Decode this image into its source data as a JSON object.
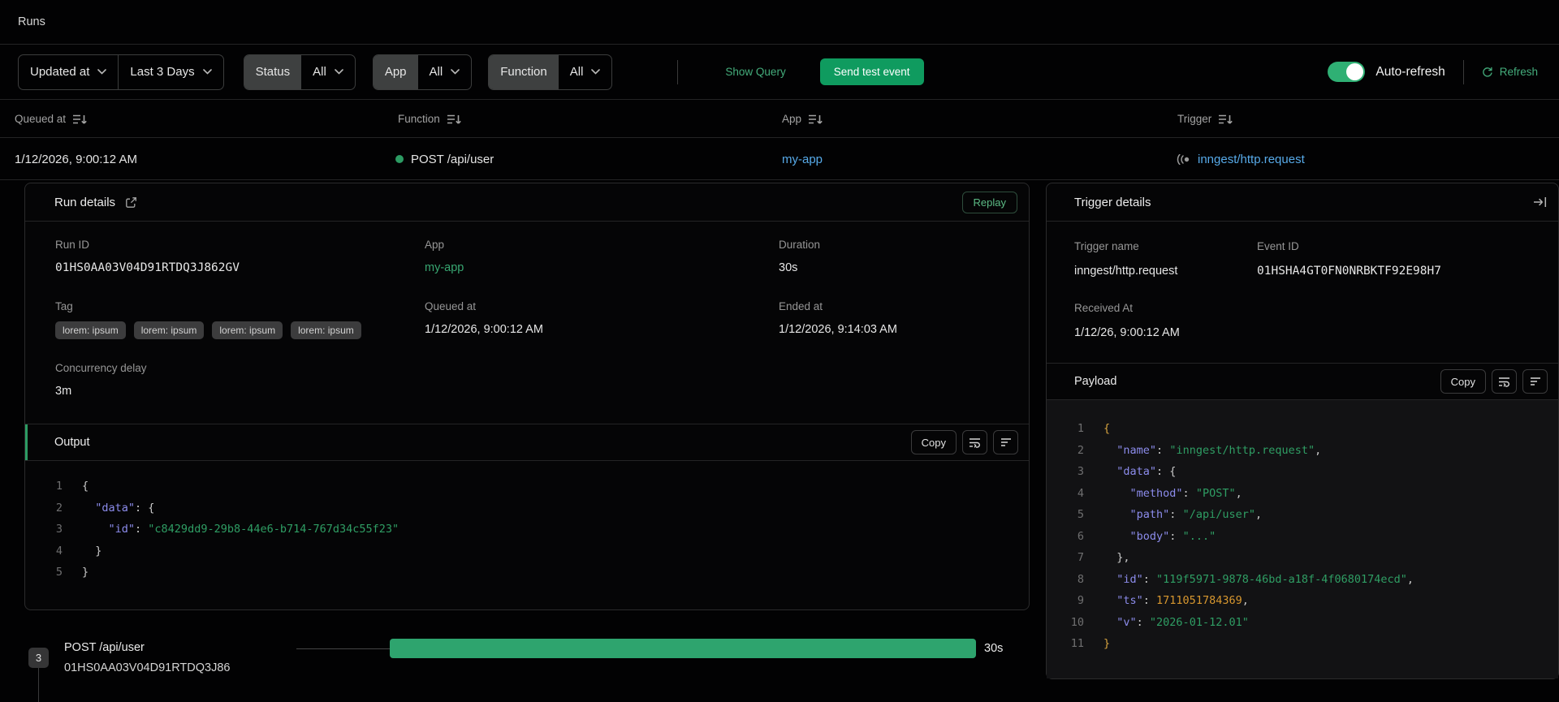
{
  "colors": {
    "accent_green": "#2c9b63",
    "link_blue": "#57aae9",
    "bar_green": "#2ea46e",
    "key_purple": "#8c8cec",
    "number_orange": "#d7972f"
  },
  "header": {
    "title": "Runs"
  },
  "filters": {
    "sort_field": "Updated at",
    "time_range": "Last 3 Days",
    "status_label": "Status",
    "status_value": "All",
    "app_label": "App",
    "app_value": "All",
    "function_label": "Function",
    "function_value": "All",
    "show_query": "Show Query",
    "send_test_event": "Send test event",
    "auto_refresh": "Auto-refresh",
    "refresh": "Refresh"
  },
  "table": {
    "headers": {
      "queued_at": "Queued at",
      "function": "Function",
      "app": "App",
      "trigger": "Trigger"
    },
    "row": {
      "queued_at": "1/12/2026, 9:00:12 AM",
      "function": "POST /api/user",
      "app": "my-app",
      "trigger": "inngest/http.request"
    }
  },
  "run_details": {
    "title": "Run details",
    "replay": "Replay",
    "run_id_label": "Run ID",
    "run_id": "01HS0AA03V04D91RTDQ3J862GV",
    "app_label": "App",
    "app": "my-app",
    "duration_label": "Duration",
    "duration": "30s",
    "tag_label": "Tag",
    "tags": [
      "lorem: ipsum",
      "lorem: ipsum",
      "lorem: ipsum",
      "lorem: ipsum"
    ],
    "queued_at_label": "Queued at",
    "queued_at": "1/12/2026, 9:00:12 AM",
    "ended_at_label": "Ended at",
    "ended_at": "1/12/2026, 9:14:03 AM",
    "concurrency_label": "Concurrency delay",
    "concurrency": "3m"
  },
  "output": {
    "title": "Output",
    "copy": "Copy",
    "code": [
      {
        "n": "1",
        "tokens": [
          [
            "punc",
            "{"
          ]
        ]
      },
      {
        "n": "2",
        "tokens": [
          [
            "punc",
            "  "
          ],
          [
            "key",
            "\"data\""
          ],
          [
            "punc",
            ": {"
          ]
        ]
      },
      {
        "n": "3",
        "tokens": [
          [
            "punc",
            "    "
          ],
          [
            "key",
            "\"id\""
          ],
          [
            "punc",
            ": "
          ],
          [
            "str",
            "\"c8429dd9-29b8-44e6-b714-767d34c55f23\""
          ]
        ]
      },
      {
        "n": "4",
        "tokens": [
          [
            "punc",
            "  }"
          ]
        ]
      },
      {
        "n": "5",
        "tokens": [
          [
            "punc",
            "}"
          ]
        ]
      }
    ]
  },
  "trigger_details": {
    "title": "Trigger details",
    "trigger_name_label": "Trigger name",
    "trigger_name": "inngest/http.request",
    "event_id_label": "Event ID",
    "event_id": "01HSHA4GT0FN0NRBKTF92E98H7",
    "received_at_label": "Received At",
    "received_at": "1/12/26, 9:00:12 AM",
    "payload": {
      "title": "Payload",
      "copy": "Copy",
      "code": [
        {
          "n": "1",
          "tokens": [
            [
              "brace",
              "{"
            ]
          ]
        },
        {
          "n": "2",
          "tokens": [
            [
              "punc",
              "  "
            ],
            [
              "key",
              "\"name\""
            ],
            [
              "punc",
              ": "
            ],
            [
              "str",
              "\"inngest/http.request\""
            ],
            [
              "punc",
              ","
            ]
          ]
        },
        {
          "n": "3",
          "tokens": [
            [
              "punc",
              "  "
            ],
            [
              "key",
              "\"data\""
            ],
            [
              "punc",
              ": {"
            ]
          ]
        },
        {
          "n": "4",
          "tokens": [
            [
              "punc",
              "    "
            ],
            [
              "key",
              "\"method\""
            ],
            [
              "punc",
              ": "
            ],
            [
              "str",
              "\"POST\""
            ],
            [
              "punc",
              ","
            ]
          ]
        },
        {
          "n": "5",
          "tokens": [
            [
              "punc",
              "    "
            ],
            [
              "key",
              "\"path\""
            ],
            [
              "punc",
              ": "
            ],
            [
              "str",
              "\"/api/user\""
            ],
            [
              "punc",
              ","
            ]
          ]
        },
        {
          "n": "6",
          "tokens": [
            [
              "punc",
              "    "
            ],
            [
              "key",
              "\"body\""
            ],
            [
              "punc",
              ": "
            ],
            [
              "str",
              "\"...\""
            ]
          ]
        },
        {
          "n": "7",
          "tokens": [
            [
              "punc",
              "  },"
            ]
          ]
        },
        {
          "n": "8",
          "tokens": [
            [
              "punc",
              "  "
            ],
            [
              "key",
              "\"id\""
            ],
            [
              "punc",
              ": "
            ],
            [
              "str",
              "\"119f5971-9878-46bd-a18f-4f0680174ecd\""
            ],
            [
              "punc",
              ","
            ]
          ]
        },
        {
          "n": "9",
          "tokens": [
            [
              "punc",
              "  "
            ],
            [
              "key",
              "\"ts\""
            ],
            [
              "punc",
              ": "
            ],
            [
              "num",
              "1711051784369"
            ],
            [
              "punc",
              ","
            ]
          ]
        },
        {
          "n": "10",
          "tokens": [
            [
              "punc",
              "  "
            ],
            [
              "key",
              "\"v\""
            ],
            [
              "punc",
              ": "
            ],
            [
              "str",
              "\"2026-01-12.01\""
            ]
          ]
        },
        {
          "n": "11",
          "tokens": [
            [
              "brace",
              "}"
            ]
          ]
        }
      ]
    }
  },
  "timeline": {
    "count": "3",
    "step_name": "POST /api/user",
    "step_id": "01HS0AA03V04D91RTDQ3J86",
    "duration": "30s"
  }
}
